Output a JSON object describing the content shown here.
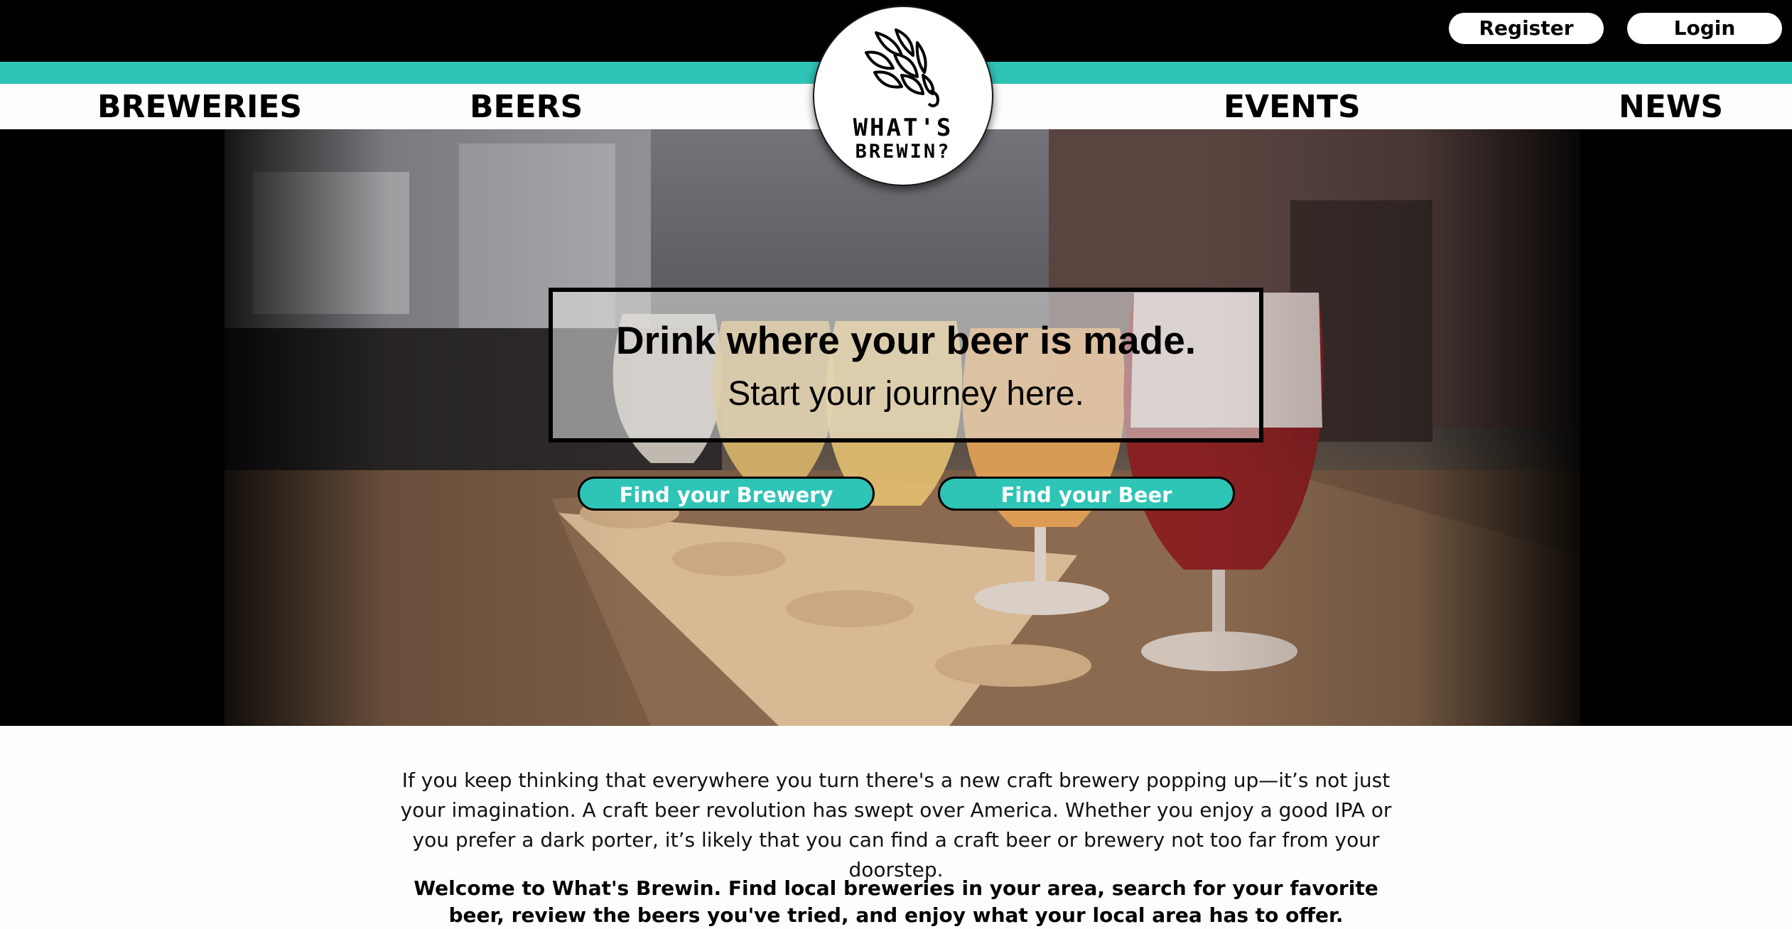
{
  "header": {
    "register_label": "Register",
    "login_label": "Login"
  },
  "nav": {
    "breweries": "BREWERIES",
    "beers": "BEERS",
    "events": "EVENTS",
    "news": "NEWS"
  },
  "logo": {
    "line1": "WHAT'S",
    "line2": "BREWIN?",
    "icon": "hop-icon"
  },
  "hero": {
    "headline": "Drink where your beer is made.",
    "subheadline": "Start your journey here.",
    "find_brewery_label": "Find your Brewery",
    "find_beer_label": "Find your Beer"
  },
  "content": {
    "intro": "If you keep thinking that everywhere you turn there's a new craft brewery popping up—it’s not just your imagination. A craft beer revolution has swept over America. Whether you enjoy a good IPA or you prefer a dark porter, it’s likely that you can find a craft beer or brewery not too far from your doorstep.",
    "welcome": "Welcome to What's Brewin. Find local breweries in your area, search for your favorite beer, review the beers you've tried, and enjoy what your local area has to offer."
  },
  "colors": {
    "accent": "#2ec4b6",
    "topbar": "#000000",
    "navbar": "#fdfdfb"
  }
}
